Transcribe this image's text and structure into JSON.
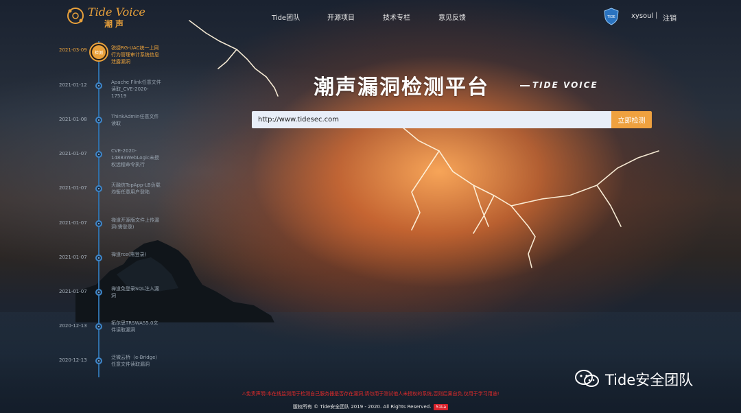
{
  "header": {
    "logo_title": "Tide Voice",
    "logo_sub": "潮声",
    "nav": [
      "Tide团队",
      "开源项目",
      "技术专栏",
      "意见反馈"
    ],
    "shield_label": "TIDE",
    "user": "xysoul",
    "separator": "|",
    "logout": "注销"
  },
  "timeline": [
    {
      "date": "2021-03-09",
      "text": "锐捷RG-UAC统一上网行为管理审计系统信息泄露漏洞",
      "badge": "检测",
      "active": true
    },
    {
      "date": "2021-01-12",
      "text": "Apache Flink任意文件读取_CVE-2020-17519",
      "active": false
    },
    {
      "date": "2021-01-08",
      "text": "ThinkAdmin任意文件读取",
      "active": false
    },
    {
      "date": "2021-01-07",
      "text": "CVE-2020-14883WebLogic未授权远程命令执行",
      "active": false
    },
    {
      "date": "2021-01-07",
      "text": "天融信TopApp-LB负载均衡任意用户登陆",
      "active": false
    },
    {
      "date": "2021-01-07",
      "text": "禅道开源版文件上传漏洞(需登录)",
      "active": false
    },
    {
      "date": "2021-01-07",
      "text": "禅道rce(需登录)",
      "active": false
    },
    {
      "date": "2021-01-07",
      "text": "禅道免登录SQL注入漏洞",
      "active": false
    },
    {
      "date": "2020-12-13",
      "text": "拓尔思TRSWAS5.0文件读取漏洞",
      "active": false
    },
    {
      "date": "2020-12-13",
      "text": "泛微云桥（e-Bridge）任意文件读取漏洞",
      "active": false
    }
  ],
  "hero": {
    "title": "潮声漏洞检测平台",
    "subtitle": "TIDE VOICE"
  },
  "search": {
    "value": "http://www.tidesec.com",
    "button": "立即检测"
  },
  "footer": {
    "disclaimer": "⚠免责声明:本在线监测用于检测自己服务器是否存在漏洞,请勿用于测试他人未授权的系统,否则后果自负,仅用于学习用途!",
    "copyright": "版权所有 © Tide安全团队 2019 - 2020. All Rights Reserved.",
    "badge": "51La"
  },
  "watermark": {
    "text": "Tide安全团队"
  },
  "colors": {
    "accent": "#e9a13b",
    "button": "#efa13f",
    "timeline": "#3e86c9",
    "warning": "#e02b2b"
  }
}
